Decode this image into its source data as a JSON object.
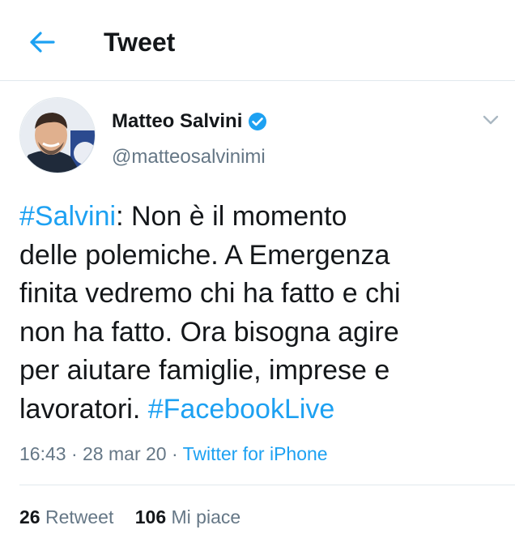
{
  "header": {
    "back_icon": "arrow-left-icon",
    "title": "Tweet"
  },
  "author": {
    "avatar_icon": "profile-photo",
    "display_name": "Matteo Salvini",
    "verified_icon": "verified-badge-icon",
    "handle": "@matteosalvinimi"
  },
  "menu": {
    "caret_icon": "chevron-down-icon"
  },
  "tweet": {
    "line1_hashtag": "#Salvini",
    "line1_rest": ": Non è il momento",
    "line2": "delle polemiche. A Emergenza",
    "line3": "finita vedremo chi ha fatto e chi",
    "line4": "non ha fatto. Ora bisogna agire",
    "line5": "per aiutare famiglie, imprese e",
    "line6_text": "lavoratori. ",
    "line6_hashtag": "#FacebookLive"
  },
  "meta": {
    "time": "16:43",
    "sep1": " · ",
    "date": "28 mar 20",
    "sep2": " · ",
    "source": "Twitter for iPhone"
  },
  "stats": {
    "retweets_count": "26",
    "retweets_label": "Retweet",
    "likes_count": "106",
    "likes_label": "Mi piace"
  },
  "colors": {
    "accent": "#1da1f2",
    "text": "#14171a",
    "secondary": "#657786",
    "divider": "#e1e8ed"
  }
}
